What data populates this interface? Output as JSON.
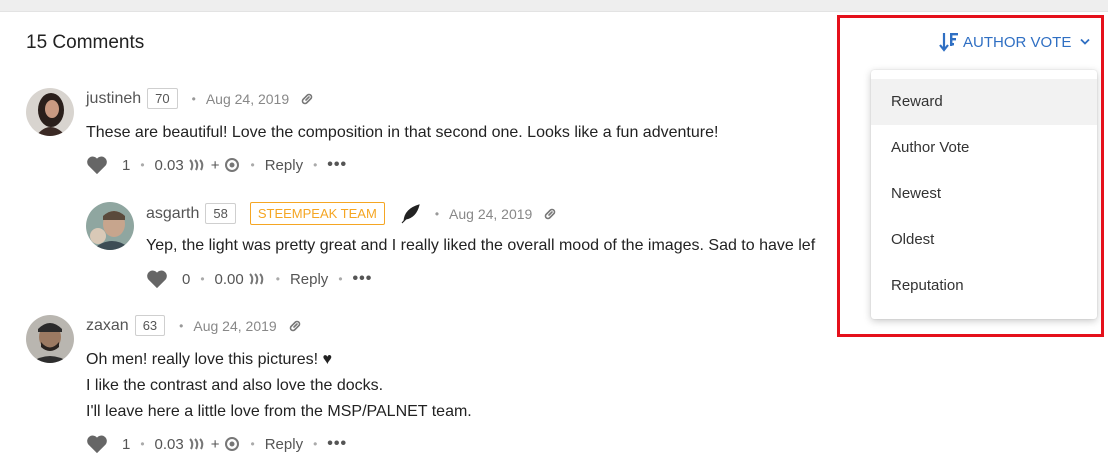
{
  "header": {
    "title": "15 Comments"
  },
  "sort": {
    "current_label": "AUTHOR VOTE",
    "options": [
      "Reward",
      "Author Vote",
      "Newest",
      "Oldest",
      "Reputation"
    ],
    "highlighted_option": "Reward"
  },
  "colors": {
    "accent": "#2f6fc3",
    "highlight_box": "#e5101b",
    "badge": "#f5a623"
  },
  "comments": [
    {
      "author": "justineh",
      "reputation": "70",
      "date": "Aug 24, 2019",
      "text": [
        "These are beautiful! Love the composition in that second one. Looks like a fun adventure!"
      ],
      "votes": "1",
      "payout": "0.03",
      "plus": "+",
      "reply_label": "Reply",
      "more_label": "•••"
    },
    {
      "author": "asgarth",
      "reputation": "58",
      "badge": "STEEMPEAK TEAM",
      "date": "Aug 24, 2019",
      "text": [
        "Yep, the light was pretty great and I really liked the overall mood of the images. Sad to have lef"
      ],
      "votes": "0",
      "payout": "0.00",
      "reply_label": "Reply",
      "more_label": "•••"
    },
    {
      "author": "zaxan",
      "reputation": "63",
      "date": "Aug 24, 2019",
      "text": [
        "Oh men! really love this pictures! ♥",
        "I like the contrast and also love the docks.",
        "I'll leave here a little love from the MSP/PALNET team."
      ],
      "votes": "1",
      "payout": "0.03",
      "plus": "+",
      "reply_label": "Reply",
      "more_label": "•••"
    }
  ]
}
